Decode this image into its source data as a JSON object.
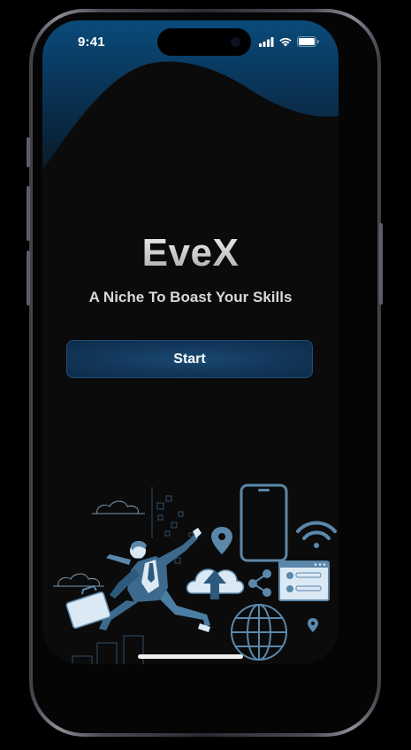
{
  "status_bar": {
    "time": "9:41",
    "icons": [
      "cellular-signal-icon",
      "wifi-icon",
      "battery-icon"
    ]
  },
  "app": {
    "title": "EveX",
    "subtitle": "A Niche To Boast Your Skills",
    "start_label": "Start"
  },
  "illustration": {
    "name": "man-running-with-tech-icons-illustration",
    "icons": [
      "location-pin-icon",
      "smartphone-icon",
      "wifi-icon",
      "cloud-upload-icon",
      "share-icon",
      "chat-window-icon",
      "globe-icon"
    ]
  },
  "colors": {
    "background": "#0b0b0c",
    "accent": "#1a4a70",
    "wave_top": "#0a4a78",
    "illustration_blue": "#5d8db0",
    "illustration_light": "#dbe9f5"
  }
}
